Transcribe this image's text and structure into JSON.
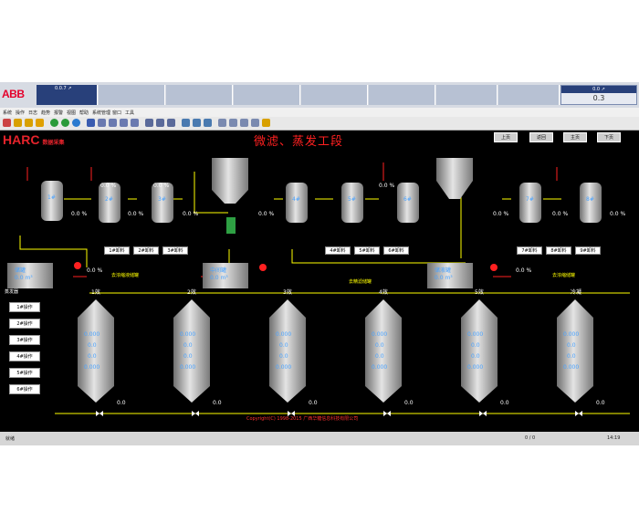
{
  "header": {
    "brand": "ABB",
    "alarm_first": "0.0.7 ↗",
    "right_box_header": "0.0 ↗",
    "right_box_value": "0.3"
  },
  "menu": [
    "系统",
    "操作",
    "日志",
    "趋势",
    "报警",
    "视图",
    "帮助",
    "系统管理",
    "窗口",
    "工具"
  ],
  "screen": {
    "logo": "HARC",
    "logo_sub": "数据采集",
    "title": "微滤、蒸发工段",
    "nav_buttons": [
      "上页",
      "返回",
      "主页",
      "下页"
    ]
  },
  "top_units": [
    {
      "id": "1#",
      "value": "0.0"
    },
    {
      "id": "2#",
      "value": "0.0"
    },
    {
      "id": "3#",
      "value": "0.0"
    },
    {
      "id": "4#",
      "value": "0.0"
    },
    {
      "id": "5#",
      "value": "0.0"
    },
    {
      "id": "6#",
      "value": "0.0"
    },
    {
      "id": "7#",
      "value": "0.0"
    },
    {
      "id": "8#",
      "value": "0.0"
    },
    {
      "id": "9#",
      "value": "0.0"
    }
  ],
  "readings": {
    "r1": "0.0 %",
    "r2": "0.0 %",
    "r3": "0.0 %",
    "r4": "0.0 %",
    "r5": "0.0 %",
    "r6": "0.0 %",
    "r7": "0.0 %",
    "r8": "0.0 %",
    "r9": "0.0 %",
    "r10": "0.0 %",
    "r11": "0.0 %",
    "r12": "0.0 %"
  },
  "small_labels": [
    "1#卸料",
    "2#卸料",
    "3#卸料",
    "4#卸料",
    "5#卸料",
    "6#卸料",
    "7#卸料",
    "8#卸料",
    "9#卸料"
  ],
  "tanks": [
    {
      "label": "储罐",
      "value": "0.0 m³"
    },
    {
      "label": "中间罐",
      "value": "0.0 m³"
    },
    {
      "label": "储液罐",
      "value": "0.0 m³"
    }
  ],
  "flow_notes": [
    "去浓缩液储罐",
    "去精滤储罐",
    "去浓缩储罐"
  ],
  "evap_header": "蒸发器",
  "evaporators": [
    {
      "id": "1效",
      "vals": [
        "0.000",
        "0.0",
        "0.0",
        "0.000"
      ],
      "bottom": "0.0"
    },
    {
      "id": "2效",
      "vals": [
        "0.000",
        "0.0",
        "0.0",
        "0.000"
      ],
      "bottom": "0.0"
    },
    {
      "id": "3效",
      "vals": [
        "0.000",
        "0.0",
        "0.0",
        "0.000"
      ],
      "bottom": "0.0"
    },
    {
      "id": "4效",
      "vals": [
        "0.000",
        "0.0",
        "0.0",
        "0.000"
      ],
      "bottom": "0.0"
    },
    {
      "id": "5效",
      "vals": [
        "0.000",
        "0.0",
        "0.0",
        "0.000"
      ],
      "bottom": "0.0"
    },
    {
      "id": "冷凝",
      "vals": [
        "0.000",
        "0.0",
        "0.0",
        "0.000"
      ],
      "bottom": "0.0"
    }
  ],
  "side_buttons": [
    "1#操作",
    "2#操作",
    "3#操作",
    "4#操作",
    "5#操作",
    "6#操作"
  ],
  "copyright": "Copyright(C) 1998-2015 广西华糖信息科技有限公司",
  "status": {
    "left": "就绪",
    "mid": "0 / 0",
    "right": "14:19"
  },
  "colors": {
    "alarm_bar": "#28407a",
    "accent_red": "#ff2020",
    "value_yellow": "#ffff00",
    "vessel": "#b8b8b8"
  }
}
